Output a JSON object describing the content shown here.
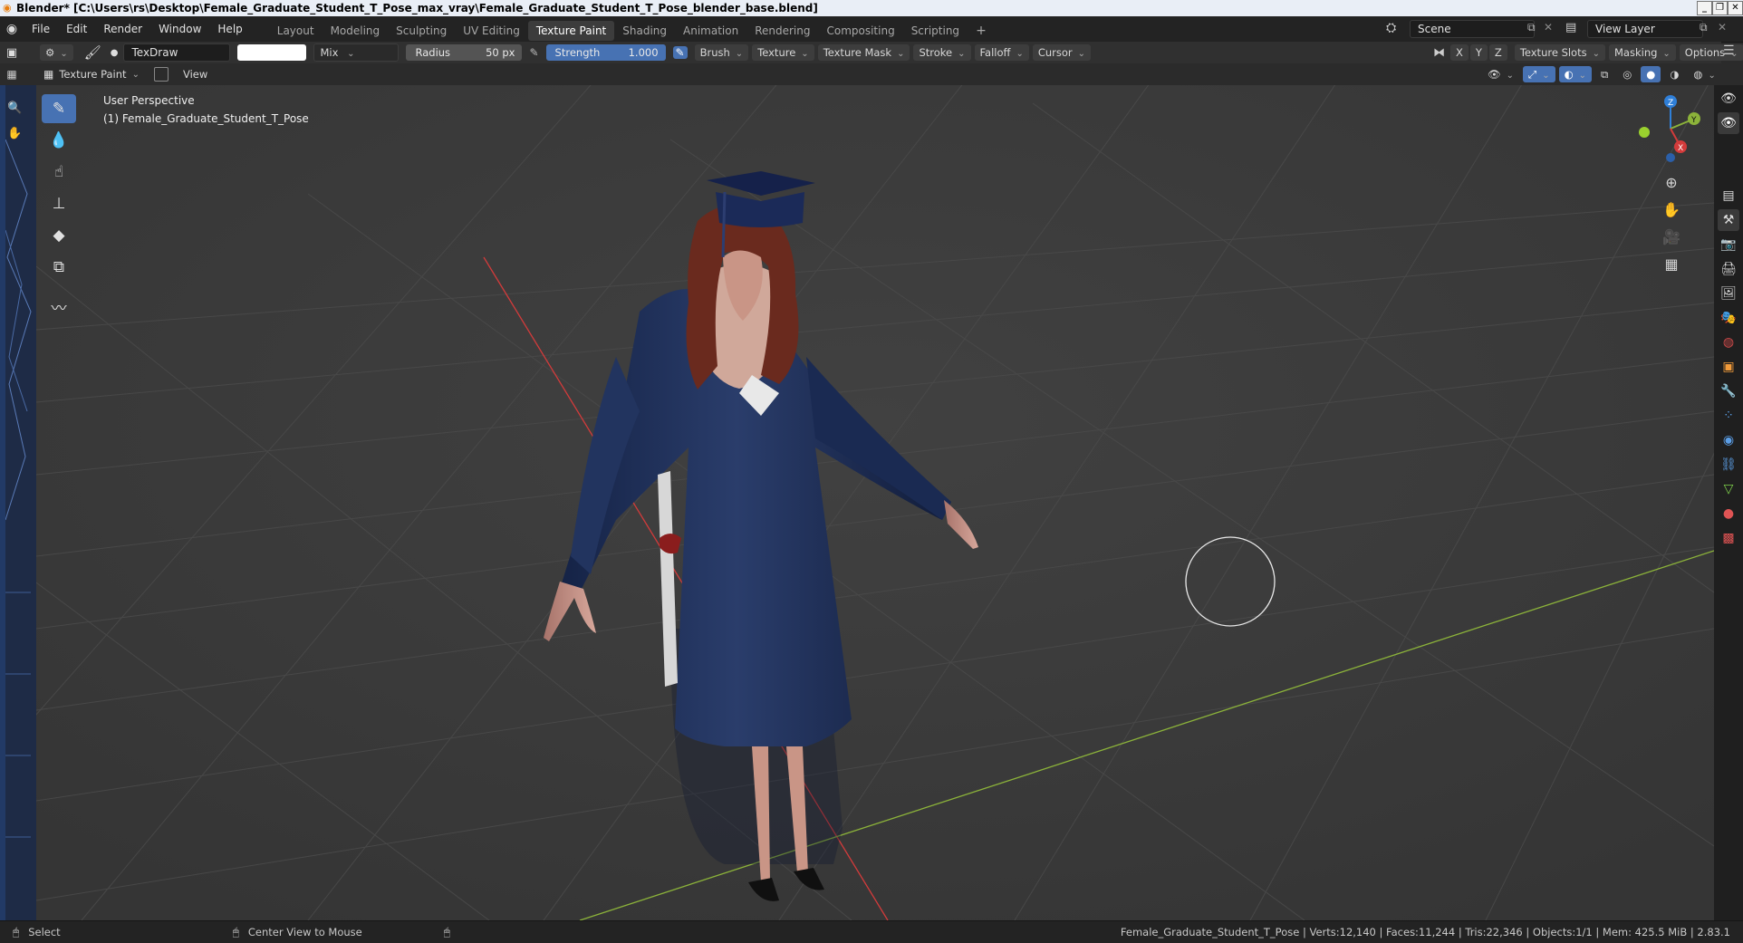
{
  "window": {
    "title": "Blender* [C:\\Users\\rs\\Desktop\\Female_Graduate_Student_T_Pose_max_vray\\Female_Graduate_Student_T_Pose_blender_base.blend]",
    "controls": [
      "_",
      "❐",
      "✕"
    ]
  },
  "menu": [
    "File",
    "Edit",
    "Render",
    "Window",
    "Help"
  ],
  "workspaces": [
    "Layout",
    "Modeling",
    "Sculpting",
    "UV Editing",
    "Texture Paint",
    "Shading",
    "Animation",
    "Rendering",
    "Compositing",
    "Scripting"
  ],
  "active_workspace": "Texture Paint",
  "add_workspace": "+",
  "scene": {
    "name": "Scene",
    "view_layer": "View Layer"
  },
  "tool_header": {
    "brush_name": "TexDraw",
    "blend_mode": "Mix",
    "radius_label": "Radius",
    "radius_value": "50 px",
    "strength_label": "Strength",
    "strength_value": "1.000",
    "menus": [
      "Brush",
      "Texture",
      "Texture Mask",
      "Stroke",
      "Falloff",
      "Cursor"
    ],
    "axes": [
      "X",
      "Y",
      "Z"
    ],
    "right_menus": [
      "Texture Slots",
      "Masking",
      "Options"
    ]
  },
  "header2": {
    "mode": "Texture Paint",
    "view": "View"
  },
  "viewport": {
    "perspective": "User Perspective",
    "object": "(1) Female_Graduate_Student_T_Pose",
    "gizmo_axes": [
      "Z",
      "Y",
      "X"
    ]
  },
  "tools": [
    "brush-draw-icon",
    "soften-icon",
    "smear-icon",
    "clone-icon",
    "fill-icon",
    "mask-icon",
    "annotate-icon"
  ],
  "status": {
    "select": "Select",
    "center": "Center View to Mouse",
    "stats": "Female_Graduate_Student_T_Pose | Verts:12,140 | Faces:11,244 | Tris:22,346 | Objects:1/1 | Mem: 425.5 MiB | 2.83.1"
  },
  "colors": {
    "accent": "#4772b3",
    "x_axis": "#d23b3b",
    "y_axis": "#8cb33a",
    "z_axis": "#2f7fd8",
    "gown": "#1b2a4e"
  }
}
